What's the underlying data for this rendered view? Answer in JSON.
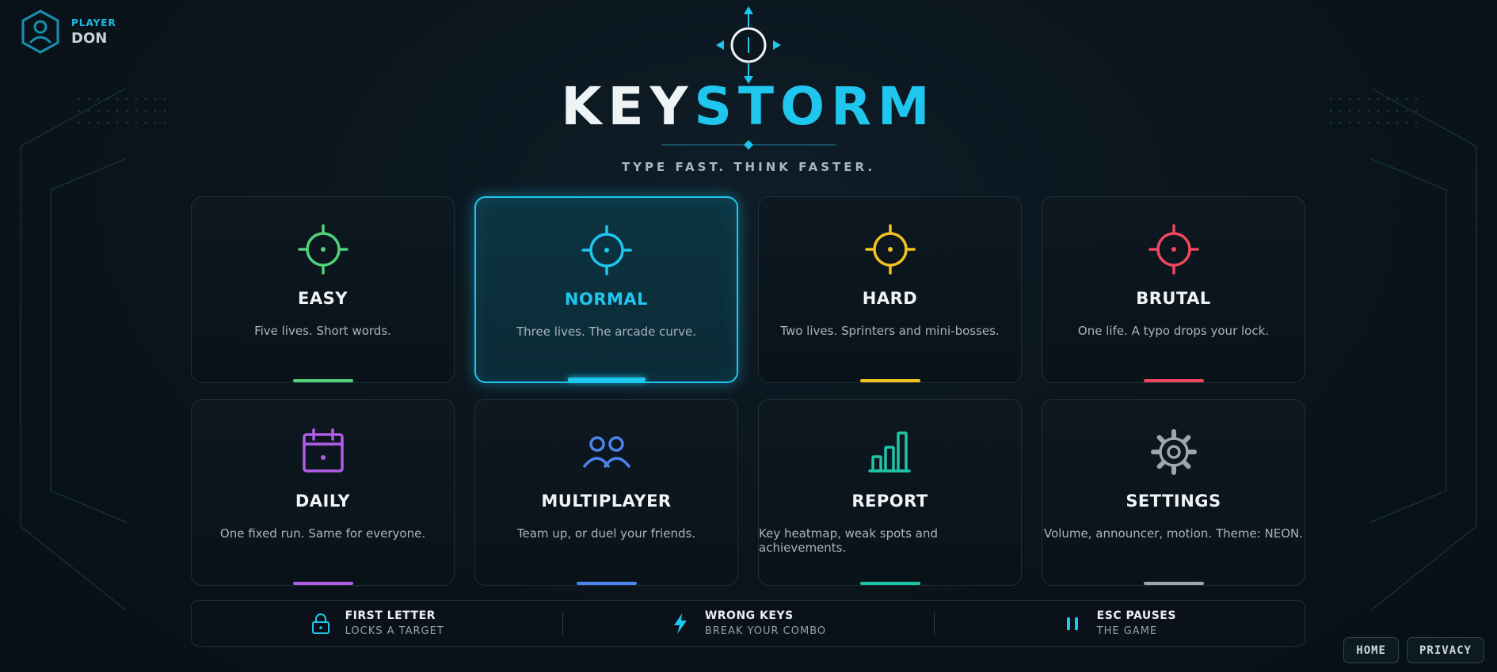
{
  "player": {
    "label": "PLAYER",
    "name": "DON"
  },
  "logo": {
    "part_a": "KEY",
    "part_b": "STORM",
    "tagline": "TYPE FAST. THINK FASTER."
  },
  "colors": {
    "accent": "#1fc6ee",
    "easy": "#4fd27a",
    "normal": "#1fc6ee",
    "hard": "#f2c21f",
    "brutal": "#f0475e",
    "daily": "#b05ee8",
    "multiplayer": "#4b83f0",
    "report": "#1fc4a8",
    "settings": "#9aa6b0"
  },
  "cards": [
    {
      "id": "easy",
      "title": "EASY",
      "desc": "Five lives. Short words.",
      "icon": "crosshair-icon",
      "color": "#4fd27a",
      "selected": false
    },
    {
      "id": "normal",
      "title": "NORMAL",
      "desc": "Three lives. The arcade curve.",
      "icon": "crosshair-icon",
      "color": "#1fc6ee",
      "selected": true
    },
    {
      "id": "hard",
      "title": "HARD",
      "desc": "Two lives. Sprinters and mini-bosses.",
      "icon": "crosshair-icon",
      "color": "#f2c21f",
      "selected": false
    },
    {
      "id": "brutal",
      "title": "BRUTAL",
      "desc": "One life. A typo drops your lock.",
      "icon": "crosshair-icon",
      "color": "#f0475e",
      "selected": false
    },
    {
      "id": "daily",
      "title": "DAILY",
      "desc": "One fixed run. Same for everyone.",
      "icon": "calendar-icon",
      "color": "#b05ee8",
      "selected": false
    },
    {
      "id": "multiplayer",
      "title": "MULTIPLAYER",
      "desc": "Team up, or duel your friends.",
      "icon": "users-icon",
      "color": "#4b83f0",
      "selected": false
    },
    {
      "id": "report",
      "title": "REPORT",
      "desc": "Key heatmap, weak spots and achievements.",
      "icon": "bar-chart-icon",
      "color": "#1fc4a8",
      "selected": false
    },
    {
      "id": "settings",
      "title": "SETTINGS",
      "desc": "Volume, announcer, motion. Theme: NEON.",
      "icon": "gear-icon",
      "color": "#9aa6b0",
      "selected": false
    }
  ],
  "hints": [
    {
      "title": "FIRST LETTER",
      "sub": "LOCKS A TARGET",
      "icon": "lock-icon"
    },
    {
      "title": "WRONG KEYS",
      "sub": "BREAK YOUR COMBO",
      "icon": "lightning-icon"
    },
    {
      "title": "ESC PAUSES",
      "sub": "THE GAME",
      "icon": "pause-icon"
    }
  ],
  "footer": {
    "home": "HOME",
    "privacy": "PRIVACY"
  }
}
